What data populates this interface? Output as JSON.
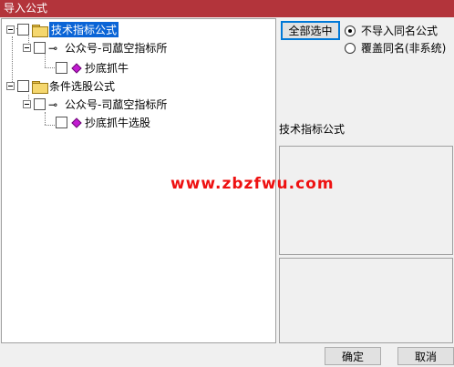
{
  "window": {
    "title": "导入公式"
  },
  "tree": {
    "nodes": [
      {
        "label": "技术指标公式",
        "selected": true
      },
      {
        "label": "公众号-司蓏空指标所"
      },
      {
        "label": "抄底抓牛"
      },
      {
        "label": "条件选股公式"
      },
      {
        "label": "公众号-司蓏空指标所"
      },
      {
        "label": "抄底抓牛选股"
      }
    ]
  },
  "options": {
    "select_all_label": "全部选中",
    "radio_no_import": "不导入同名公式",
    "radio_overwrite": "覆盖同名(非系统)",
    "selected_radio": "no_import"
  },
  "info": {
    "label": "技术指标公式"
  },
  "watermark": "www.zbzfwu.com",
  "footer": {
    "ok_label": "确定",
    "cancel_label": "取消"
  }
}
